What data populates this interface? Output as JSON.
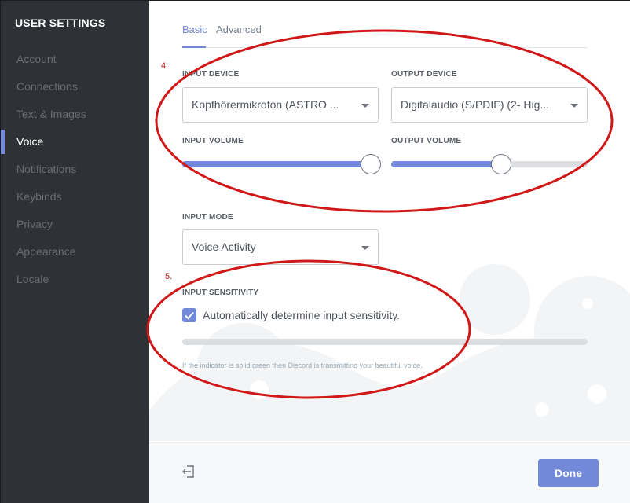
{
  "sidebar": {
    "title": "USER SETTINGS",
    "items": [
      {
        "label": "Account"
      },
      {
        "label": "Connections"
      },
      {
        "label": "Text & Images"
      },
      {
        "label": "Voice",
        "active": true
      },
      {
        "label": "Notifications"
      },
      {
        "label": "Keybinds"
      },
      {
        "label": "Privacy"
      },
      {
        "label": "Appearance"
      },
      {
        "label": "Locale"
      }
    ]
  },
  "tabs": {
    "basic": "Basic",
    "advanced": "Advanced",
    "active": "Basic"
  },
  "input_device": {
    "label": "INPUT DEVICE",
    "value": "Kopfhörermikrofon (ASTRO ..."
  },
  "output_device": {
    "label": "OUTPUT DEVICE",
    "value": "Digitalaudio (S/PDIF) (2- Hig..."
  },
  "input_volume": {
    "label": "INPUT VOLUME",
    "level_percent": 100
  },
  "output_volume": {
    "label": "OUTPUT VOLUME",
    "level_percent": 56
  },
  "input_mode": {
    "label": "INPUT MODE",
    "value": "Voice Activity"
  },
  "input_sensitivity": {
    "label": "INPUT SENSITIVITY",
    "auto_checkbox_label": "Automatically determine input sensitivity.",
    "auto_checked": true,
    "help_text": "If the indicator is solid green then Discord is transmitting your beautiful voice."
  },
  "footer": {
    "done_label": "Done",
    "logout_icon": "logout-icon"
  },
  "annotations": {
    "marker_4": "4.",
    "marker_5": "5."
  },
  "colors": {
    "accent": "#7289da",
    "sidebar_bg": "#2e3136",
    "annotation": "#d01818"
  }
}
